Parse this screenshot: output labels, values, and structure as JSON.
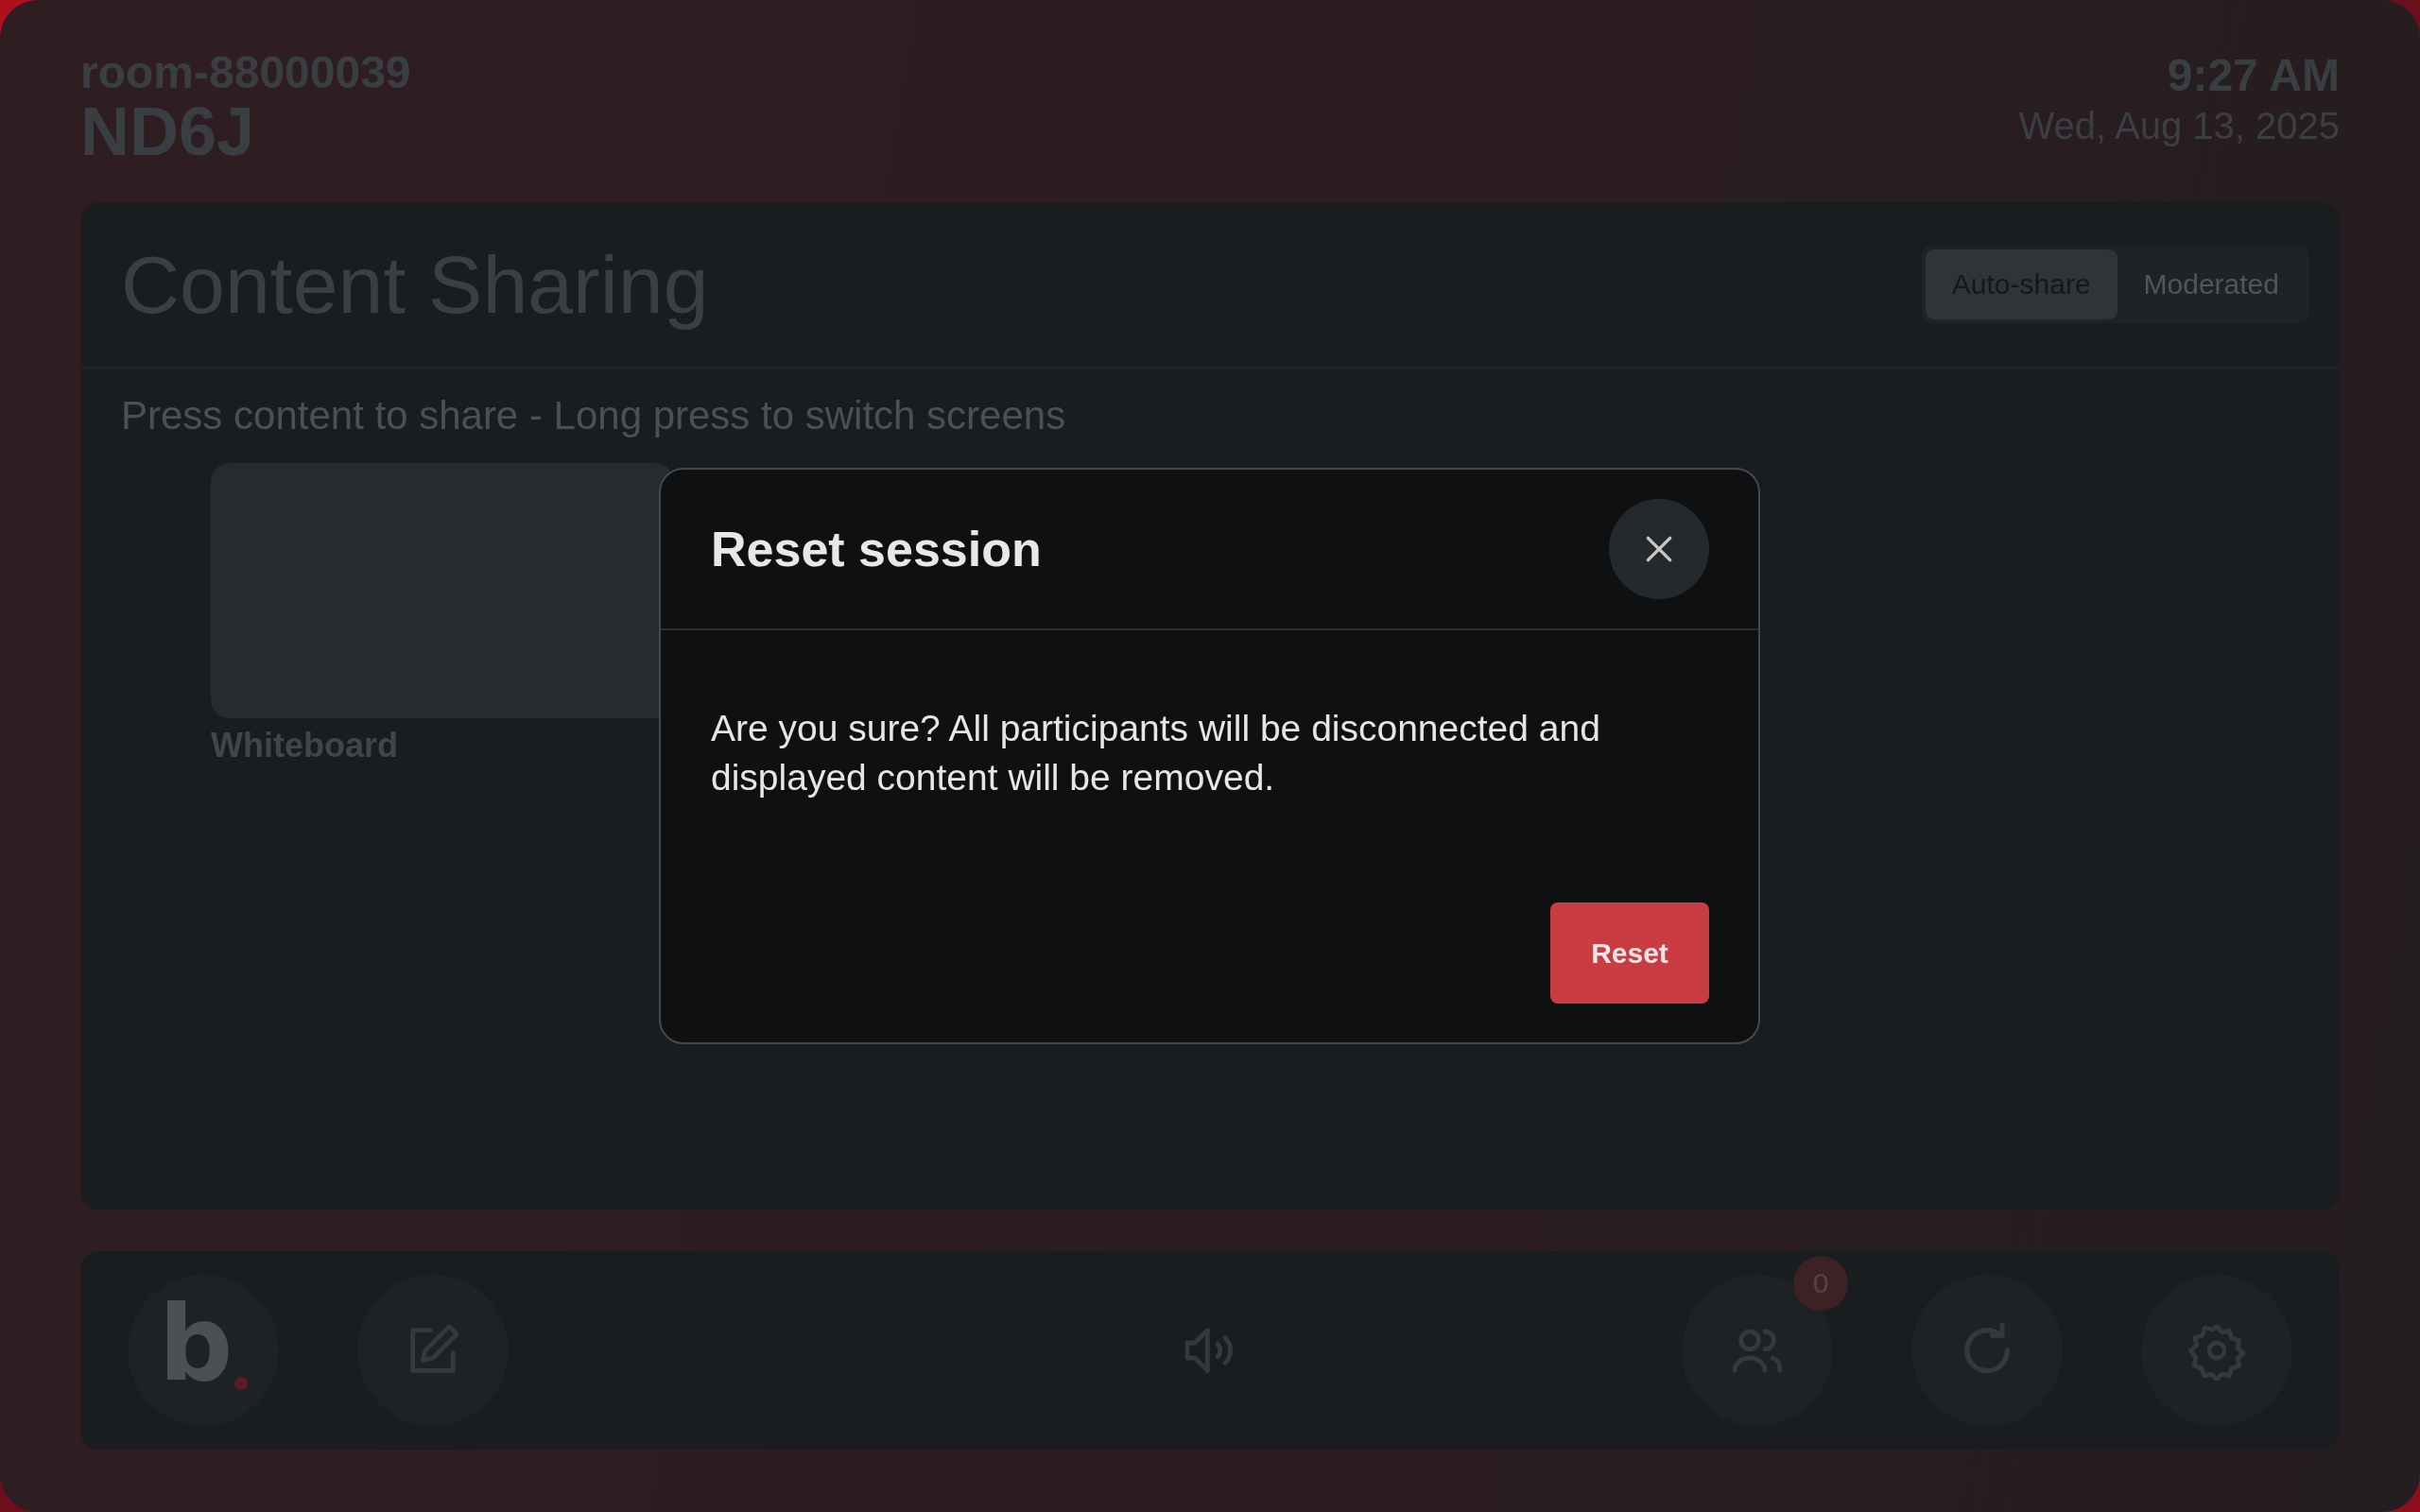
{
  "header": {
    "room": "room-88000039",
    "code": "ND6J",
    "time": "9:27 AM",
    "date": "Wed, Aug 13, 2025"
  },
  "panel": {
    "title": "Content Sharing",
    "modes": [
      {
        "label": "Auto-share",
        "selected": true
      },
      {
        "label": "Moderated",
        "selected": false
      }
    ],
    "hint": "Press content to share - Long press to switch screens",
    "sources": [
      {
        "label": "Whiteboard"
      }
    ]
  },
  "toolbar": {
    "buttons": [
      {
        "kind": "logo",
        "label": "b"
      },
      {
        "kind": "edit"
      },
      {
        "kind": "speaker"
      },
      {
        "kind": "people",
        "badge": "0"
      },
      {
        "kind": "refresh"
      },
      {
        "kind": "settings"
      }
    ]
  },
  "dialog": {
    "title": "Reset session",
    "message": "Are you sure? All participants will be disconnected and displayed content will be removed.",
    "confirm": "Reset"
  }
}
